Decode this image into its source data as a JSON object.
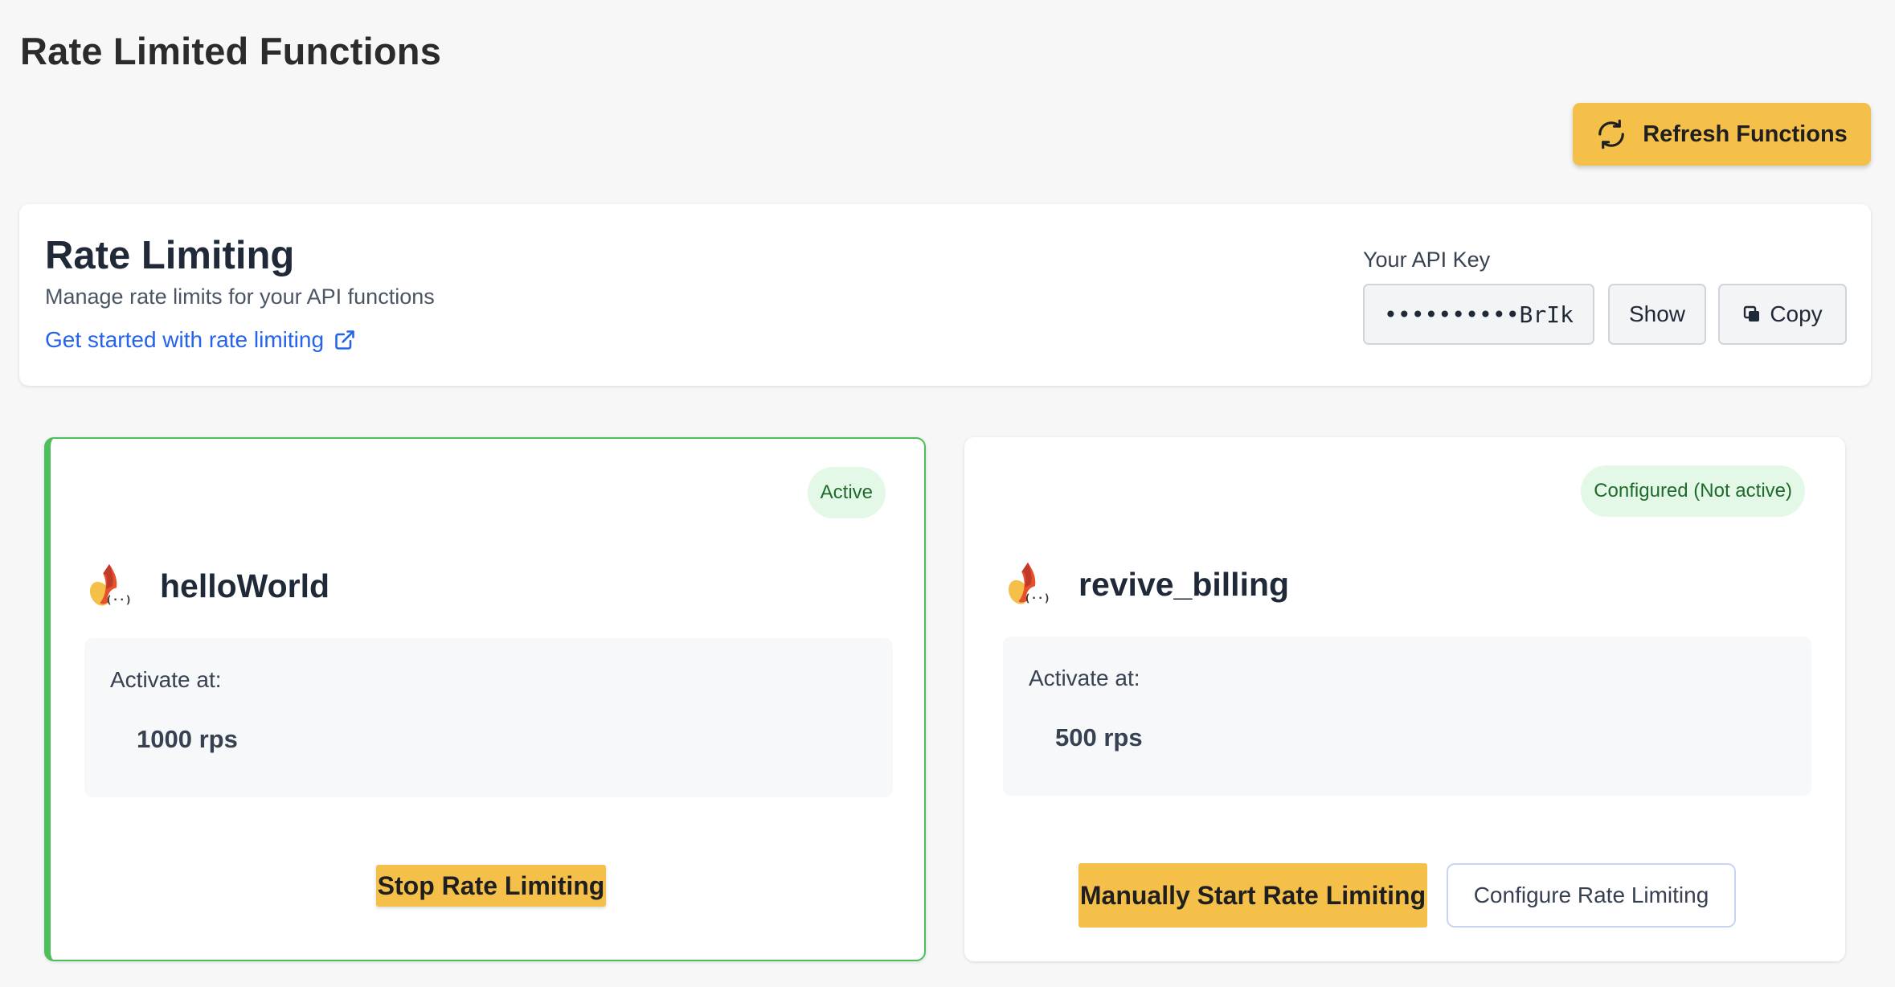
{
  "page": {
    "title": "Rate Limited Functions"
  },
  "toolbar": {
    "refresh_label": "Refresh Functions"
  },
  "rate_limiting": {
    "heading": "Rate Limiting",
    "subtitle": "Manage rate limits for your API functions",
    "link_text": "Get started with rate limiting",
    "api_key_label": "Your API Key",
    "api_key_masked": "••••••••••BrIk",
    "show_label": "Show",
    "copy_label": "Copy"
  },
  "functions": [
    {
      "name": "helloWorld",
      "status": "Active",
      "activate_label": "Activate at:",
      "activate_value": "1000 rps",
      "primary_action": "Stop Rate Limiting"
    },
    {
      "name": "revive_billing",
      "status": "Configured (Not active)",
      "activate_label": "Activate at:",
      "activate_value": "500 rps",
      "primary_action": "Manually Start Rate Limiting",
      "secondary_action": "Configure Rate Limiting"
    }
  ],
  "colors": {
    "accent": "#f4c04a",
    "active_border": "#4cbf5a",
    "badge_bg": "#e3f8e6",
    "badge_text": "#1f6b2e",
    "link": "#2563eb"
  },
  "icons": [
    "refresh-icon",
    "external-link-icon",
    "copy-icon",
    "firebase-functions-icon"
  ]
}
